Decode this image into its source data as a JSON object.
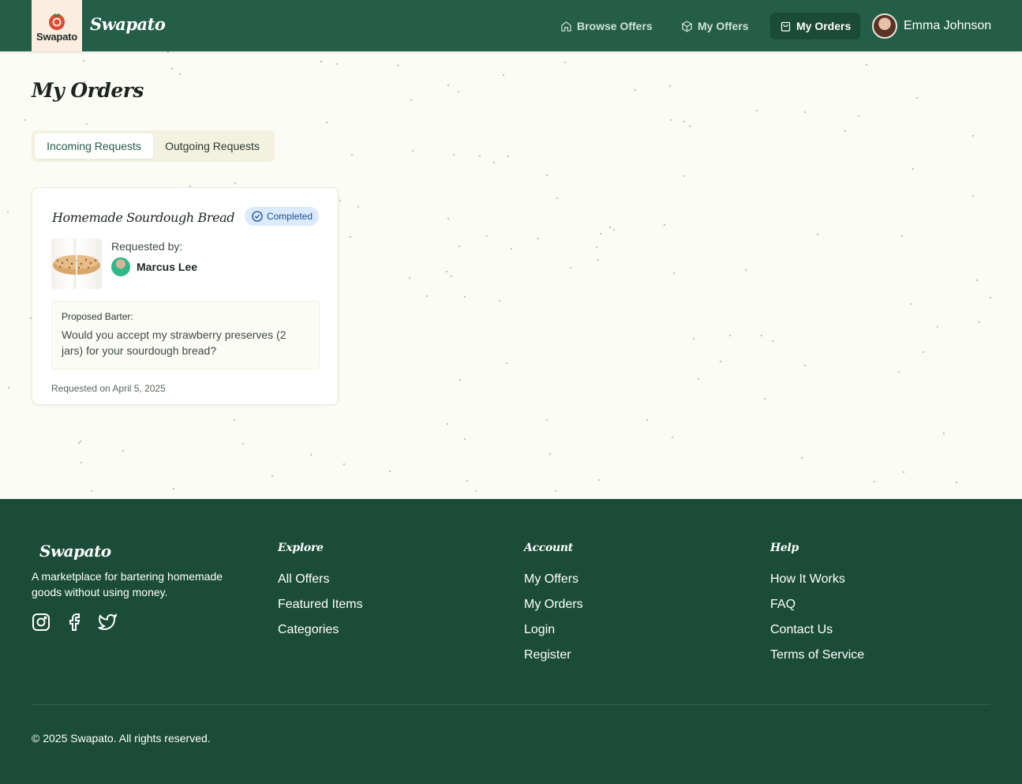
{
  "header": {
    "logo_text": "Swapato",
    "brand_name": "Swapato",
    "nav": [
      {
        "label": "Browse Offers",
        "icon": "home-icon"
      },
      {
        "label": "My Offers",
        "icon": "package-icon"
      },
      {
        "label": "My Orders",
        "icon": "shopping-bag-icon"
      }
    ],
    "user_name": "Emma Johnson"
  },
  "page": {
    "title": "My Orders",
    "tabs": [
      {
        "label": "Incoming Requests",
        "active": true
      },
      {
        "label": "Outgoing Requests",
        "active": false
      }
    ]
  },
  "order": {
    "title": "Homemade Sourdough Bread",
    "status": "Completed",
    "requested_by_label": "Requested by:",
    "requester_name": "Marcus Lee",
    "barter_label": "Proposed Barter:",
    "barter_text": "Would you accept my strawberry preserves (2 jars) for your sourdough bread?",
    "requested_on": "Requested on April 5, 2025"
  },
  "footer": {
    "brand": "Swapato",
    "tagline": "A marketplace for bartering homemade goods without using money.",
    "socials": [
      "instagram-icon",
      "facebook-icon",
      "twitter-icon"
    ],
    "columns": [
      {
        "heading": "Explore",
        "links": [
          "All Offers",
          "Featured Items",
          "Categories"
        ]
      },
      {
        "heading": "Account",
        "links": [
          "My Offers",
          "My Orders",
          "Login",
          "Register"
        ]
      },
      {
        "heading": "Help",
        "links": [
          "How It Works",
          "FAQ",
          "Contact Us",
          "Terms of Service"
        ]
      }
    ],
    "copyright": "© 2025 Swapato. All rights reserved."
  },
  "colors": {
    "header_bg": "#245d48",
    "footer_bg": "#1b4c3a",
    "page_bg": "#fcfcf6",
    "status_badge_bg": "#dbeafe",
    "status_badge_text": "#1e4f8f"
  }
}
